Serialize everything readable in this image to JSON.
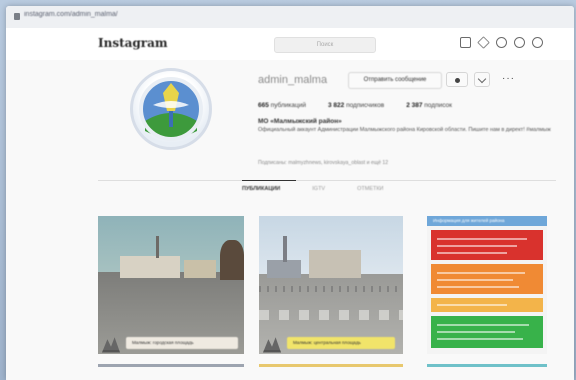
{
  "browser": {
    "url": "instagram.com/admin_malma/"
  },
  "app": {
    "logo": "Instagram",
    "search_placeholder": "Поиск"
  },
  "nav_icons": [
    "home-icon",
    "direct-icon",
    "explore-icon",
    "heart-icon",
    "profile-icon"
  ],
  "profile": {
    "username": "admin_malma",
    "message_button": "Отправить сообщение",
    "more_label": "···",
    "stats": [
      {
        "value": "665",
        "label": "публикаций"
      },
      {
        "value": "3 822",
        "label": "подписчиков"
      },
      {
        "value": "2 387",
        "label": "подписок"
      }
    ],
    "name": "МО «Малмыжский район»",
    "bio": "Официальный аккаунт Администрации Малмыжского района Кировской области. Пишите нам в директ! #малмыж",
    "followed_by": "Подписаны: malmyzhnews, kirovskaya_oblast и ещё 12"
  },
  "tabs": [
    {
      "label": "ПУБЛИКАЦИИ",
      "active": true
    },
    {
      "label": "IGTV",
      "active": false
    },
    {
      "label": "ОТМЕТКИ",
      "active": false
    }
  ],
  "posts": [
    {
      "type": "photo",
      "caption": "Малмыж: городская площадь"
    },
    {
      "type": "photo",
      "caption": "Малмыж: центральная площадь"
    },
    {
      "type": "infographic",
      "caption": "Информация для жителей района"
    }
  ],
  "colors": {
    "accent_red": "#d9322d",
    "accent_orange": "#f08a34",
    "accent_green": "#38b24a",
    "caption_yellow": "#f1e46a"
  }
}
